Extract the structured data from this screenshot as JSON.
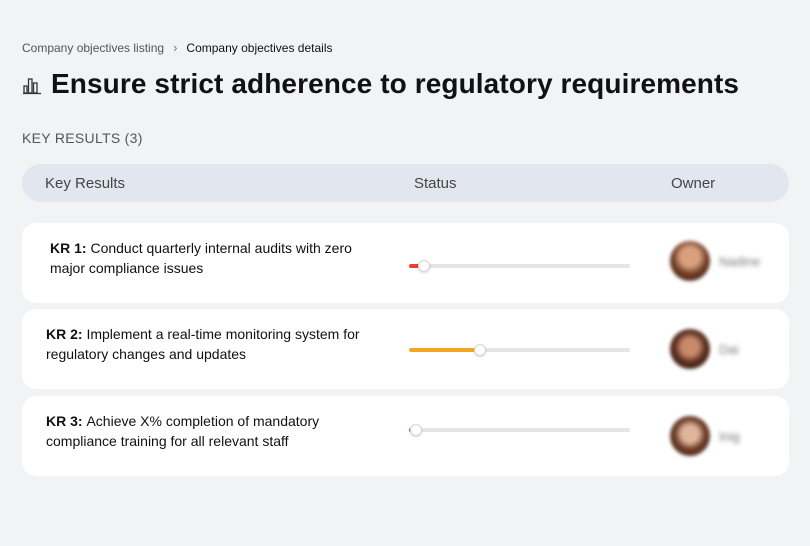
{
  "breadcrumb": {
    "parent": "Company objectives listing",
    "separator": "›",
    "current": "Company objectives details"
  },
  "objective": {
    "icon": "building-chart-icon",
    "title": "Ensure strict adherence to regulatory requirements"
  },
  "key_results_label": "KEY RESULTS (3)",
  "table": {
    "headers": {
      "key_results": "Key Results",
      "status": "Status",
      "owner": "Owner"
    }
  },
  "key_results": [
    {
      "id": "KR 1:",
      "text": "Conduct quarterly internal audits with zero major compliance issues",
      "progress": 0.07,
      "color": "#e8432f",
      "owner": "Nadine"
    },
    {
      "id": "KR 2:",
      "text": "Implement a real-time monitoring system for regulatory changes and updates",
      "progress": 0.32,
      "color": "#f5a623",
      "owner": "Dai"
    },
    {
      "id": "KR 3:",
      "text": "Achieve X% completion of mandatory compliance training for all relevant staff",
      "progress": 0.03,
      "color": "#e8432f",
      "owner": "Inig"
    }
  ],
  "colors": {
    "background": "#f2f3f5",
    "header_bg": "#e2e7ef",
    "low_progress": "#e8432f",
    "mid_progress": "#f5a623"
  }
}
